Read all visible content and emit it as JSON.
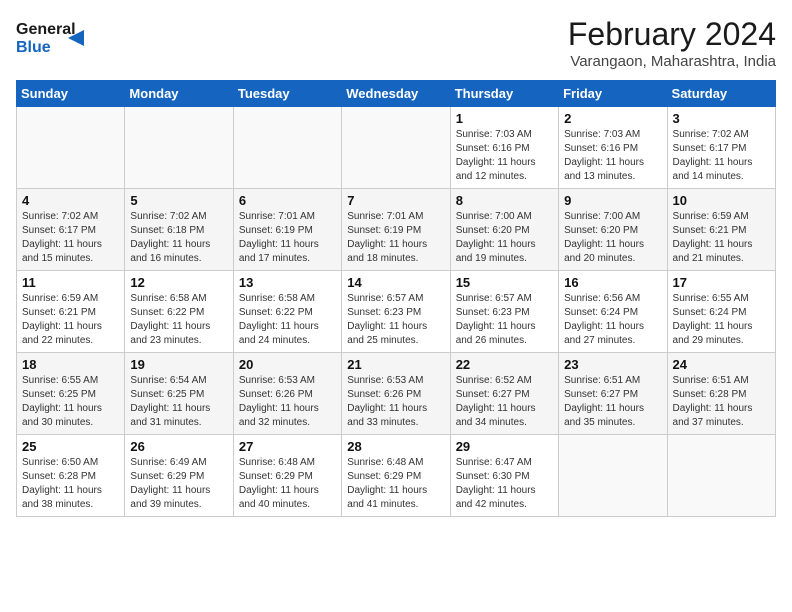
{
  "header": {
    "logo_line1": "General",
    "logo_line2": "Blue",
    "title": "February 2024",
    "subtitle": "Varangaon, Maharashtra, India"
  },
  "days_of_week": [
    "Sunday",
    "Monday",
    "Tuesday",
    "Wednesday",
    "Thursday",
    "Friday",
    "Saturday"
  ],
  "weeks": [
    [
      {
        "day": "",
        "sunrise": "",
        "sunset": "",
        "daylight": "",
        "empty": true
      },
      {
        "day": "",
        "sunrise": "",
        "sunset": "",
        "daylight": "",
        "empty": true
      },
      {
        "day": "",
        "sunrise": "",
        "sunset": "",
        "daylight": "",
        "empty": true
      },
      {
        "day": "",
        "sunrise": "",
        "sunset": "",
        "daylight": "",
        "empty": true
      },
      {
        "day": "1",
        "sunrise": "Sunrise: 7:03 AM",
        "sunset": "Sunset: 6:16 PM",
        "daylight": "Daylight: 11 hours and 12 minutes."
      },
      {
        "day": "2",
        "sunrise": "Sunrise: 7:03 AM",
        "sunset": "Sunset: 6:16 PM",
        "daylight": "Daylight: 11 hours and 13 minutes."
      },
      {
        "day": "3",
        "sunrise": "Sunrise: 7:02 AM",
        "sunset": "Sunset: 6:17 PM",
        "daylight": "Daylight: 11 hours and 14 minutes."
      }
    ],
    [
      {
        "day": "4",
        "sunrise": "Sunrise: 7:02 AM",
        "sunset": "Sunset: 6:17 PM",
        "daylight": "Daylight: 11 hours and 15 minutes."
      },
      {
        "day": "5",
        "sunrise": "Sunrise: 7:02 AM",
        "sunset": "Sunset: 6:18 PM",
        "daylight": "Daylight: 11 hours and 16 minutes."
      },
      {
        "day": "6",
        "sunrise": "Sunrise: 7:01 AM",
        "sunset": "Sunset: 6:19 PM",
        "daylight": "Daylight: 11 hours and 17 minutes."
      },
      {
        "day": "7",
        "sunrise": "Sunrise: 7:01 AM",
        "sunset": "Sunset: 6:19 PM",
        "daylight": "Daylight: 11 hours and 18 minutes."
      },
      {
        "day": "8",
        "sunrise": "Sunrise: 7:00 AM",
        "sunset": "Sunset: 6:20 PM",
        "daylight": "Daylight: 11 hours and 19 minutes."
      },
      {
        "day": "9",
        "sunrise": "Sunrise: 7:00 AM",
        "sunset": "Sunset: 6:20 PM",
        "daylight": "Daylight: 11 hours and 20 minutes."
      },
      {
        "day": "10",
        "sunrise": "Sunrise: 6:59 AM",
        "sunset": "Sunset: 6:21 PM",
        "daylight": "Daylight: 11 hours and 21 minutes."
      }
    ],
    [
      {
        "day": "11",
        "sunrise": "Sunrise: 6:59 AM",
        "sunset": "Sunset: 6:21 PM",
        "daylight": "Daylight: 11 hours and 22 minutes."
      },
      {
        "day": "12",
        "sunrise": "Sunrise: 6:58 AM",
        "sunset": "Sunset: 6:22 PM",
        "daylight": "Daylight: 11 hours and 23 minutes."
      },
      {
        "day": "13",
        "sunrise": "Sunrise: 6:58 AM",
        "sunset": "Sunset: 6:22 PM",
        "daylight": "Daylight: 11 hours and 24 minutes."
      },
      {
        "day": "14",
        "sunrise": "Sunrise: 6:57 AM",
        "sunset": "Sunset: 6:23 PM",
        "daylight": "Daylight: 11 hours and 25 minutes."
      },
      {
        "day": "15",
        "sunrise": "Sunrise: 6:57 AM",
        "sunset": "Sunset: 6:23 PM",
        "daylight": "Daylight: 11 hours and 26 minutes."
      },
      {
        "day": "16",
        "sunrise": "Sunrise: 6:56 AM",
        "sunset": "Sunset: 6:24 PM",
        "daylight": "Daylight: 11 hours and 27 minutes."
      },
      {
        "day": "17",
        "sunrise": "Sunrise: 6:55 AM",
        "sunset": "Sunset: 6:24 PM",
        "daylight": "Daylight: 11 hours and 29 minutes."
      }
    ],
    [
      {
        "day": "18",
        "sunrise": "Sunrise: 6:55 AM",
        "sunset": "Sunset: 6:25 PM",
        "daylight": "Daylight: 11 hours and 30 minutes."
      },
      {
        "day": "19",
        "sunrise": "Sunrise: 6:54 AM",
        "sunset": "Sunset: 6:25 PM",
        "daylight": "Daylight: 11 hours and 31 minutes."
      },
      {
        "day": "20",
        "sunrise": "Sunrise: 6:53 AM",
        "sunset": "Sunset: 6:26 PM",
        "daylight": "Daylight: 11 hours and 32 minutes."
      },
      {
        "day": "21",
        "sunrise": "Sunrise: 6:53 AM",
        "sunset": "Sunset: 6:26 PM",
        "daylight": "Daylight: 11 hours and 33 minutes."
      },
      {
        "day": "22",
        "sunrise": "Sunrise: 6:52 AM",
        "sunset": "Sunset: 6:27 PM",
        "daylight": "Daylight: 11 hours and 34 minutes."
      },
      {
        "day": "23",
        "sunrise": "Sunrise: 6:51 AM",
        "sunset": "Sunset: 6:27 PM",
        "daylight": "Daylight: 11 hours and 35 minutes."
      },
      {
        "day": "24",
        "sunrise": "Sunrise: 6:51 AM",
        "sunset": "Sunset: 6:28 PM",
        "daylight": "Daylight: 11 hours and 37 minutes."
      }
    ],
    [
      {
        "day": "25",
        "sunrise": "Sunrise: 6:50 AM",
        "sunset": "Sunset: 6:28 PM",
        "daylight": "Daylight: 11 hours and 38 minutes."
      },
      {
        "day": "26",
        "sunrise": "Sunrise: 6:49 AM",
        "sunset": "Sunset: 6:29 PM",
        "daylight": "Daylight: 11 hours and 39 minutes."
      },
      {
        "day": "27",
        "sunrise": "Sunrise: 6:48 AM",
        "sunset": "Sunset: 6:29 PM",
        "daylight": "Daylight: 11 hours and 40 minutes."
      },
      {
        "day": "28",
        "sunrise": "Sunrise: 6:48 AM",
        "sunset": "Sunset: 6:29 PM",
        "daylight": "Daylight: 11 hours and 41 minutes."
      },
      {
        "day": "29",
        "sunrise": "Sunrise: 6:47 AM",
        "sunset": "Sunset: 6:30 PM",
        "daylight": "Daylight: 11 hours and 42 minutes."
      },
      {
        "day": "",
        "sunrise": "",
        "sunset": "",
        "daylight": "",
        "empty": true
      },
      {
        "day": "",
        "sunrise": "",
        "sunset": "",
        "daylight": "",
        "empty": true
      }
    ]
  ],
  "colors": {
    "header_bg": "#1565c0",
    "logo_blue": "#1565c0"
  }
}
